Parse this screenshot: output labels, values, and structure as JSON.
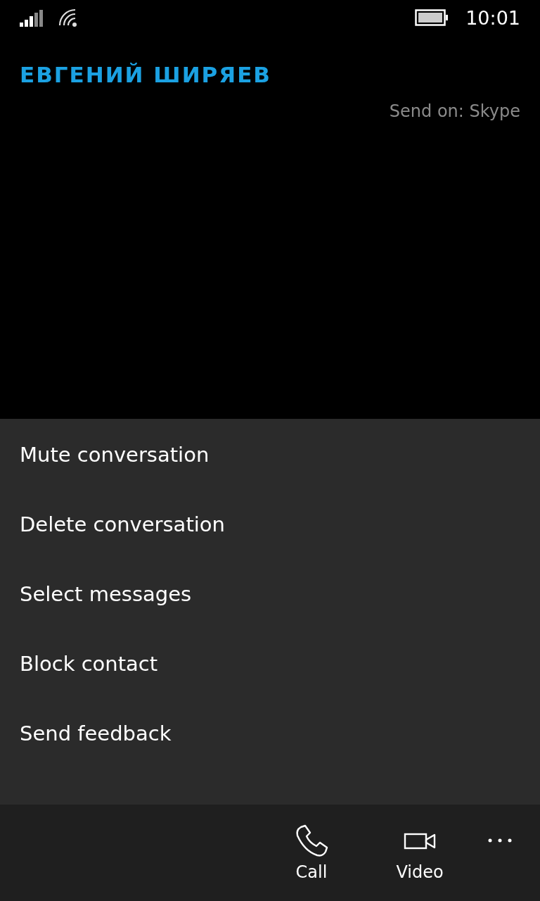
{
  "status_bar": {
    "time": "10:01"
  },
  "header": {
    "contact_name": "ЕВГЕНИЙ ШИРЯЕВ",
    "send_on": "Send on: Skype"
  },
  "menu": {
    "items": [
      {
        "label": "Mute conversation"
      },
      {
        "label": "Delete conversation"
      },
      {
        "label": "Select messages"
      },
      {
        "label": "Block contact"
      },
      {
        "label": "Send feedback"
      }
    ]
  },
  "app_bar": {
    "buttons": [
      {
        "kind": "call",
        "label": "Call"
      },
      {
        "kind": "video",
        "label": "Video"
      }
    ]
  }
}
